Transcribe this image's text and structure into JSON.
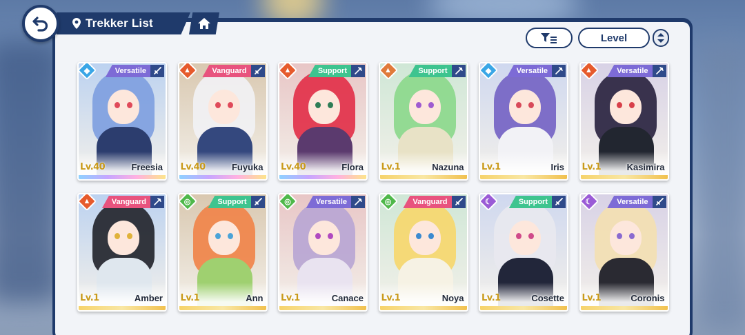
{
  "header": {
    "title": "Trekker List",
    "sort_label": "Level"
  },
  "colors": {
    "navy": "#1f3a6b",
    "aqua": "#3aa6e6",
    "ignis": "#e65a2c",
    "ventus": "#4fb84a",
    "umbra": "#9a5bd6",
    "versatile": "#7d6bd6",
    "vanguard": "#e8537e",
    "support": "#3ec48f"
  },
  "cards": [
    {
      "name": "Freesia",
      "level": "Lv.40",
      "role": "Versatile",
      "element": "aqua",
      "weapon": "sword-icon",
      "rarity": "purple",
      "hair": "#7f9fe0",
      "body": "#2c3d6e",
      "eye": "#e04a5a"
    },
    {
      "name": "Fuyuka",
      "level": "Lv.40",
      "role": "Vanguard",
      "element": "ignis",
      "weapon": "sword-icon",
      "rarity": "purple",
      "hair": "#f1f1f4",
      "body": "#34487e",
      "eye": "#e04a5a"
    },
    {
      "name": "Flora",
      "level": "Lv.40",
      "role": "Support",
      "element": "ignis",
      "weapon": "staff-icon",
      "rarity": "purple",
      "hair": "#e2314a",
      "body": "#5b3a6e",
      "eye": "#2e7d56"
    },
    {
      "name": "Nazuna",
      "level": "Lv.1",
      "role": "Support",
      "element": "terra",
      "weapon": "staff-icon",
      "rarity": "gold",
      "hair": "#8cd88c",
      "body": "#e8e2c6",
      "eye": "#9f5bd0"
    },
    {
      "name": "Iris",
      "level": "Lv.1",
      "role": "Versatile",
      "element": "aqua",
      "weapon": "staff-icon",
      "rarity": "gold",
      "hair": "#7564c4",
      "body": "#f2f2f6",
      "eye": "#d84a5a"
    },
    {
      "name": "Kasimira",
      "level": "Lv.1",
      "role": "Versatile",
      "element": "ignis",
      "weapon": "staff-icon",
      "rarity": "gold",
      "hair": "#2a2440",
      "body": "#222630",
      "eye": "#d8404a"
    },
    {
      "name": "Amber",
      "level": "Lv.1",
      "role": "Vanguard",
      "element": "ignis",
      "weapon": "staff-icon",
      "rarity": "gold",
      "hair": "#24262e",
      "body": "#dfe7ee",
      "eye": "#e0b23a"
    },
    {
      "name": "Ann",
      "level": "Lv.1",
      "role": "Support",
      "element": "ventus",
      "weapon": "sword-icon",
      "rarity": "gold",
      "hair": "#f0844a",
      "body": "#9fd070",
      "eye": "#4aa3d8"
    },
    {
      "name": "Canace",
      "level": "Lv.1",
      "role": "Versatile",
      "element": "ventus",
      "weapon": "staff-icon",
      "rarity": "gold",
      "hair": "#b9a6d4",
      "body": "#e9e3f0",
      "eye": "#b04ac0"
    },
    {
      "name": "Noya",
      "level": "Lv.1",
      "role": "Vanguard",
      "element": "ventus",
      "weapon": "sword-icon",
      "rarity": "gold",
      "hair": "#f6d76e",
      "body": "#f6f2e4",
      "eye": "#3a8ad0"
    },
    {
      "name": "Cosette",
      "level": "Lv.1",
      "role": "Support",
      "element": "umbra",
      "weapon": "sword-icon",
      "rarity": "gold",
      "hair": "#e8e8ef",
      "body": "#22263a",
      "eye": "#d04a8a"
    },
    {
      "name": "Coronis",
      "level": "Lv.1",
      "role": "Versatile",
      "element": "umbra",
      "weapon": "sword-icon",
      "rarity": "gold",
      "hair": "#f3e0b2",
      "body": "#2a2a32",
      "eye": "#8a6ad0"
    }
  ]
}
